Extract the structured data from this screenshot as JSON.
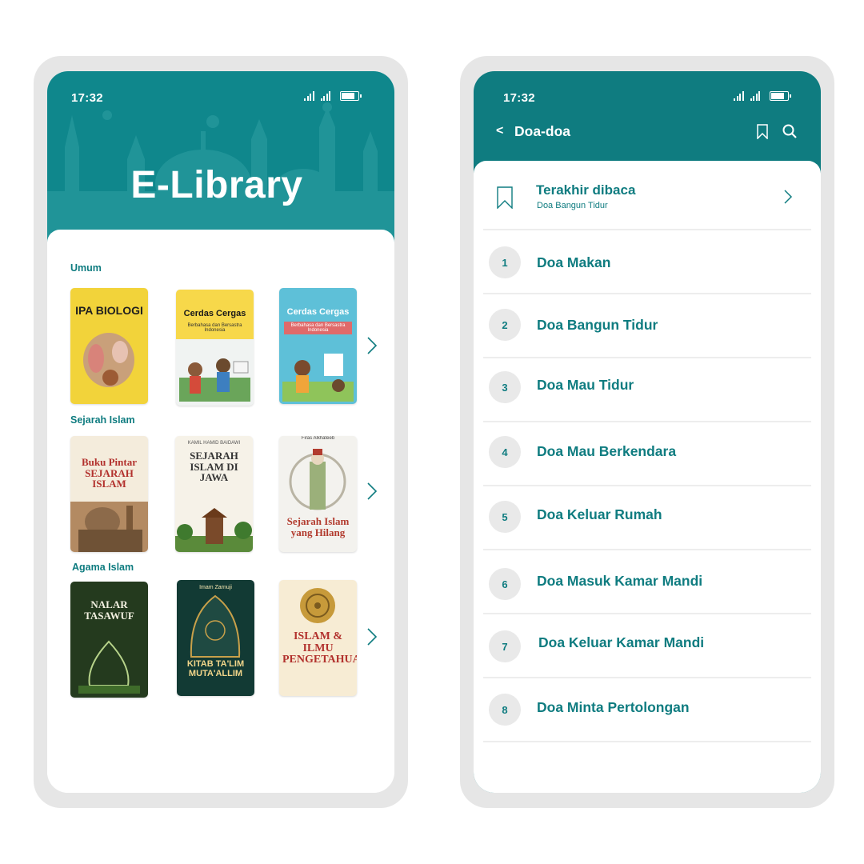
{
  "colors": {
    "teal": "#0f878c",
    "teal_dark": "#0f7c80",
    "frame": "#e6e6e6",
    "circle": "#e9e9e9"
  },
  "status_bar": {
    "time": "17:32"
  },
  "library": {
    "title": "E-Library",
    "sections": [
      {
        "title": "Umum",
        "books": [
          {
            "title": "IPA BIOLOGI",
            "subtitle": ""
          },
          {
            "title": "Cerdas Cergas",
            "subtitle": "Berbahasa dan Bersastra Indonesia"
          },
          {
            "title": "Cerdas Cergas",
            "subtitle": "Berbahasa dan Bersastra Indonesia"
          }
        ]
      },
      {
        "title": "Sejarah Islam",
        "books": [
          {
            "title": "Buku Pintar SEJARAH ISLAM",
            "subtitle": ""
          },
          {
            "title": "SEJARAH ISLAM DI JAWA",
            "subtitle": "KAMIL HAMID BAIDAWI"
          },
          {
            "title": "Sejarah Islam yang Hilang",
            "subtitle": "Firas Alkhateeb"
          }
        ]
      },
      {
        "title": "Agama Islam",
        "books": [
          {
            "title": "NALAR TASAWUF",
            "subtitle": ""
          },
          {
            "title": "KITAB TA'LIM MUTA'ALLIM",
            "subtitle": "Imam Zarnuji"
          },
          {
            "title": "ISLAM & ILMU PENGETAHUAN",
            "subtitle": ""
          }
        ]
      }
    ]
  },
  "doa": {
    "back_label": "<",
    "title": "Doa-doa",
    "last_read": {
      "label": "Terakhir dibaca",
      "item": "Doa Bangun Tidur"
    },
    "items": [
      {
        "number": "1",
        "name": "Doa Makan"
      },
      {
        "number": "2",
        "name": "Doa Bangun Tidur"
      },
      {
        "number": "3",
        "name": "Doa Mau Tidur"
      },
      {
        "number": "4",
        "name": "Doa Mau Berkendara"
      },
      {
        "number": "5",
        "name": "Doa Keluar Rumah"
      },
      {
        "number": "6",
        "name": "Doa Masuk Kamar Mandi"
      },
      {
        "number": "7",
        "name": "Doa Keluar Kamar Mandi"
      },
      {
        "number": "8",
        "name": "Doa Minta Pertolongan"
      }
    ]
  }
}
